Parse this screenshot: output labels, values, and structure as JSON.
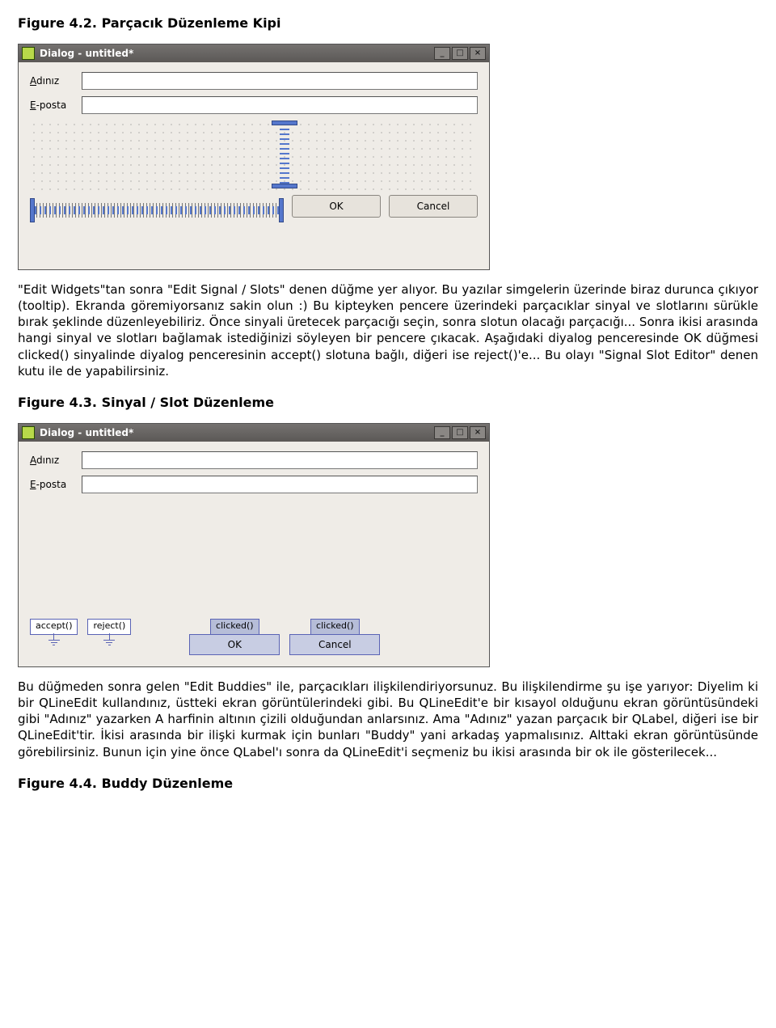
{
  "fig42": {
    "caption": "Figure 4.2. Parçacık Düzenleme Kipi",
    "window_title": "Dialog - untitled*",
    "label_name_pre": "A",
    "label_name_post": "dınız",
    "label_email_pre": "E",
    "label_email_post": "-posta",
    "btn_ok": "OK",
    "btn_cancel": "Cancel"
  },
  "para1": "\"Edit Widgets\"tan sonra \"Edit Signal / Slots\" denen düğme yer alıyor. Bu yazılar simgelerin üzerinde biraz durunca çıkıyor (tooltip). Ekranda göremiyorsanız sakin olun :) Bu kipteyken pencere üzerindeki parçacıklar sinyal ve slotlarını sürükle bırak şeklinde düzenleyebiliriz. Önce sinyali üretecek parçacığı seçin, sonra slotun olacağı parçacığı... Sonra ikisi arasında hangi sinyal ve slotları bağlamak istediğinizi söyleyen bir pencere çıkacak. Aşağıdaki diyalog penceresinde OK düğmesi clicked() sinyalinde diyalog penceresinin accept() slotuna bağlı, diğeri ise reject()'e... Bu olayı \"Signal Slot Editor\" denen kutu ile de yapabilirsiniz.",
  "fig43": {
    "caption": "Figure 4.3. Sinyal / Slot Düzenleme",
    "window_title": "Dialog - untitled*",
    "label_name_pre": "A",
    "label_name_post": "dınız",
    "label_email_pre": "E",
    "label_email_post": "-posta",
    "sig_accept": "accept()",
    "sig_reject": "reject()",
    "sig_clicked1": "clicked()",
    "sig_clicked2": "clicked()",
    "btn_ok": "OK",
    "btn_cancel": "Cancel"
  },
  "para2": "Bu düğmeden sonra gelen \"Edit Buddies\" ile, parçacıkları ilişkilendiriyorsunuz. Bu ilişkilendirme şu işe yarıyor: Diyelim ki bir QLineEdit kullandınız, üstteki ekran görüntülerindeki gibi. Bu QLineEdit'e bir kısayol olduğunu ekran görüntüsündeki gibi \"Adınız\" yazarken A harfinin altının çizili olduğundan anlarsınız. Ama \"Adınız\" yazan parçacık bir QLabel, diğeri ise bir QLineEdit'tir. İkisi arasında bir ilişki kurmak için bunları \"Buddy\" yani arkadaş yapmalısınız. Alttaki ekran görüntüsünde görebilirsiniz. Bunun için yine önce QLabel'ı sonra da QLineEdit'i seçmeniz bu ikisi arasında bir ok ile gösterilecek...",
  "fig44": {
    "caption": "Figure 4.4. Buddy Düzenleme"
  }
}
